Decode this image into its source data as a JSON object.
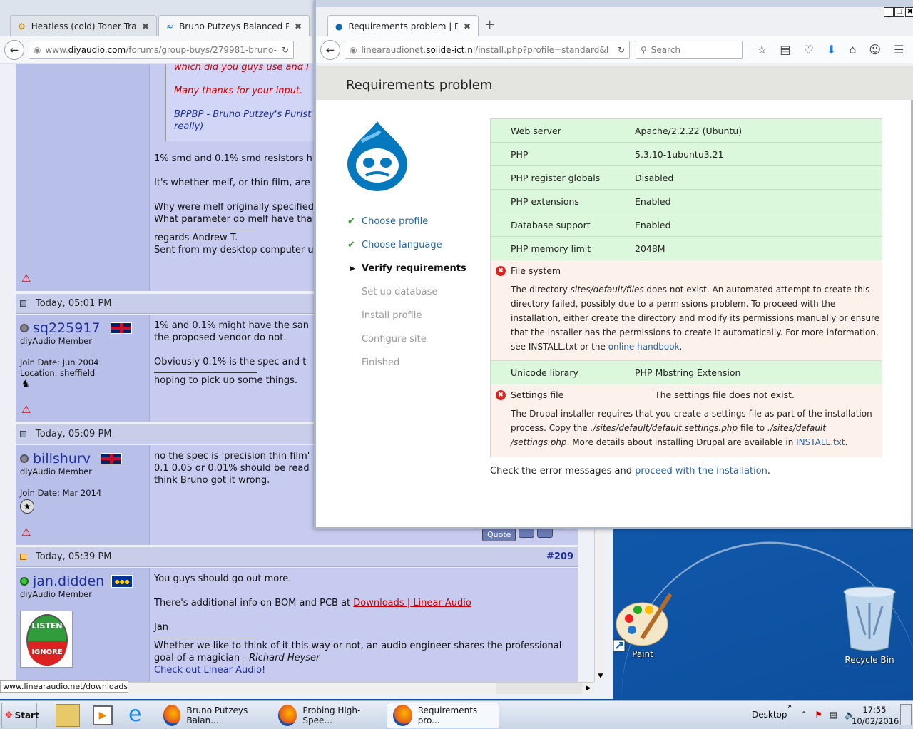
{
  "back_window": {
    "tabs": [
      {
        "label": "Heatless (cold) Toner Tran..."
      },
      {
        "label": "Bruno Putzeys Balanced Pr..."
      }
    ],
    "url_gray": "www.",
    "url_dark": "diyaudio.com",
    "url_rest": "/forums/group-buys/279981-bruno-pu",
    "status_url": "www.linearaudio.net/downloads",
    "post1": {
      "quote_lines": [
        "which did you guys use and I",
        "Many thanks for your input.",
        "BPPBP - Bruno Putzey's Purist",
        "really)"
      ],
      "lines": [
        "1% smd and 0.1% smd resistors h",
        "It's whether melf, or thin film, are",
        "Why were melf originally specified",
        "What parameter do melf have tha",
        "regards Andrew T.",
        "Sent from my desktop computer u"
      ]
    },
    "post2": {
      "time": "Today, 05:01 PM",
      "username": "sq225917",
      "role": "diyAudio Member",
      "join": "Join Date: Jun 2004",
      "location": "Location: sheffield",
      "lines": [
        "1% and 0.1% might have the san",
        "the proposed vendor do not.",
        "Obviously 0.1% is the spec and t",
        "hoping to pick up some things."
      ]
    },
    "post3": {
      "time": "Today, 05:09 PM",
      "username": "billshurv",
      "role": "diyAudio Member",
      "join": "Join Date: Mar 2014",
      "lines": [
        "no the spec is 'precision thin film'",
        "0.1 0.05 or 0.01% should be read",
        "think Bruno got it wrong."
      ],
      "quote_btn": "Quote"
    },
    "post4": {
      "time": "Today, 05:39 PM",
      "number": "#209",
      "username": "jan.didden",
      "role": "diyAudio Member",
      "avatar_top": "LISTEN",
      "avatar_bottom": "IGNORE",
      "line1": "You guys should go out more.",
      "line2_pre": "There's additional info on BOM and PCB at ",
      "line2_link": "Downloads | Linear Audio",
      "line3": "Jan",
      "sig1": "Whether we like to think of it this way or not, an audio engineer shares the professional",
      "sig2_pre": "goal of a magician - ",
      "sig2_name": "Richard Heyser",
      "sig3": "Check out Linear Audio!"
    }
  },
  "front_window": {
    "tab_label": "Requirements problem | Dr...",
    "url_pre": "linearaudionet.",
    "url_dark": "solide-ict.nl",
    "url_post": "/install.php?profile=standard&l",
    "search_placeholder": "Search",
    "page_title": "Requirements problem",
    "steps": [
      {
        "label": "Choose profile"
      },
      {
        "label": "Choose language"
      },
      {
        "label": "Verify requirements"
      },
      {
        "label": "Set up database"
      },
      {
        "label": "Install profile"
      },
      {
        "label": "Configure site"
      },
      {
        "label": "Finished"
      }
    ],
    "requirements": [
      {
        "name": "Web server",
        "value": "Apache/2.2.22 (Ubuntu)"
      },
      {
        "name": "PHP",
        "value": "5.3.10-1ubuntu3.21"
      },
      {
        "name": "PHP register globals",
        "value": "Disabled"
      },
      {
        "name": "PHP extensions",
        "value": "Enabled"
      },
      {
        "name": "Database support",
        "value": "Enabled"
      },
      {
        "name": "PHP memory limit",
        "value": "2048M"
      }
    ],
    "fs": {
      "name": "File system",
      "l1_pre": "The directory ",
      "l1_em": "sites/default/files",
      "l1_post": " does not exist. An automated attempt to create this",
      "l2": "directory failed, possibly due to a permissions problem. To proceed with the",
      "l3": "installation, either create the directory and modify its permissions manually or ensure",
      "l4": "that the installer has the permissions to create it automatically. For more information,",
      "l5_pre": "see INSTALL.txt or the ",
      "l5_link": "online handbook",
      "l5_post": "."
    },
    "unicode": {
      "name": "Unicode library",
      "value": "PHP Mbstring Extension"
    },
    "settings": {
      "name": "Settings file",
      "value": "The settings file does not exist.",
      "l1": "The Drupal installer requires that you create a settings file as part of the installation",
      "l2_pre": "process. Copy the ",
      "l2_em1": "./sites/default/default.settings.php",
      "l2_mid": " file to ",
      "l2_em2": "./sites/default",
      "l3_em": "/settings.php",
      "l3_mid": ". More details about installing Drupal are available in ",
      "l3_link": "INSTALL.txt",
      "l3_post": "."
    },
    "footer_pre": "Check the error messages and ",
    "footer_link": "proceed with the installation",
    "footer_post": "."
  },
  "desktop": {
    "icons": [
      {
        "label": "Paint"
      },
      {
        "label": "Recycle Bin"
      }
    ]
  },
  "taskbar": {
    "start": "Start",
    "items": [
      {
        "label": "Bruno Putzeys Balan..."
      },
      {
        "label": "Probing High-Spee..."
      },
      {
        "label": "Requirements pro..."
      }
    ],
    "desktop_label": "Desktop",
    "time": "17:55",
    "date": "10/02/2016"
  }
}
